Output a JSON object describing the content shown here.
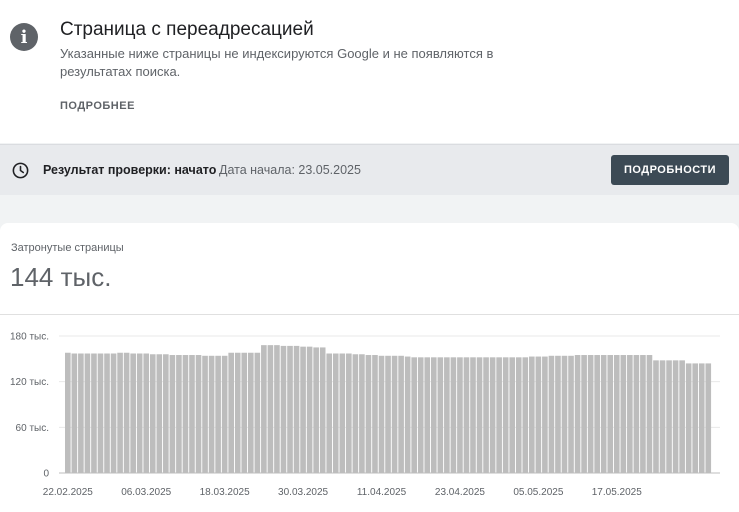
{
  "header": {
    "title": "Страница с переадресацией",
    "description": "Указанные ниже страницы не индексируются Google и не появляются в результатах поиска.",
    "more_link": "ПОДРОБНЕЕ",
    "icon": "info-icon"
  },
  "status": {
    "label": "Результат проверки: начато",
    "date_text": "Дата начала: 23.05.2025",
    "button": "ПОДРОБНОСТИ",
    "icon": "clock-icon"
  },
  "metric": {
    "label": "Затронутые страницы",
    "value": "144 тыс."
  },
  "chart_data": {
    "type": "bar",
    "bar_color": "#bdbdbd",
    "grid": true,
    "ylim": [
      0,
      180000
    ],
    "y_ticks": [
      {
        "value": 0,
        "label": "0"
      },
      {
        "value": 60000,
        "label": "60 тыс."
      },
      {
        "value": 120000,
        "label": "120 тыс."
      },
      {
        "value": 180000,
        "label": "180 тыс."
      }
    ],
    "x_tick_labels": [
      "22.02.2025",
      "06.03.2025",
      "18.03.2025",
      "30.03.2025",
      "11.04.2025",
      "23.04.2025",
      "05.05.2025",
      "17.05.2025"
    ],
    "x_tick_indices": [
      0,
      12,
      24,
      36,
      48,
      60,
      72,
      84
    ],
    "categories": [
      "22.02.2025",
      "23.02.2025",
      "24.02.2025",
      "25.02.2025",
      "26.02.2025",
      "27.02.2025",
      "28.02.2025",
      "01.03.2025",
      "02.03.2025",
      "03.03.2025",
      "04.03.2025",
      "05.03.2025",
      "06.03.2025",
      "07.03.2025",
      "08.03.2025",
      "09.03.2025",
      "10.03.2025",
      "11.03.2025",
      "12.03.2025",
      "13.03.2025",
      "14.03.2025",
      "15.03.2025",
      "16.03.2025",
      "17.03.2025",
      "18.03.2025",
      "19.03.2025",
      "20.03.2025",
      "21.03.2025",
      "22.03.2025",
      "23.03.2025",
      "24.03.2025",
      "25.03.2025",
      "26.03.2025",
      "27.03.2025",
      "28.03.2025",
      "29.03.2025",
      "30.03.2025",
      "31.03.2025",
      "01.04.2025",
      "02.04.2025",
      "03.04.2025",
      "04.04.2025",
      "05.04.2025",
      "06.04.2025",
      "07.04.2025",
      "08.04.2025",
      "09.04.2025",
      "10.04.2025",
      "11.04.2025",
      "12.04.2025",
      "13.04.2025",
      "14.04.2025",
      "15.04.2025",
      "16.04.2025",
      "17.04.2025",
      "18.04.2025",
      "19.04.2025",
      "20.04.2025",
      "21.04.2025",
      "22.04.2025",
      "23.04.2025",
      "24.04.2025",
      "25.04.2025",
      "26.04.2025",
      "27.04.2025",
      "28.04.2025",
      "29.04.2025",
      "30.04.2025",
      "01.05.2025",
      "02.05.2025",
      "03.05.2025",
      "04.05.2025",
      "05.05.2025",
      "06.05.2025",
      "07.05.2025",
      "08.05.2025",
      "09.05.2025",
      "10.05.2025",
      "11.05.2025",
      "12.05.2025",
      "13.05.2025",
      "14.05.2025",
      "15.05.2025",
      "16.05.2025",
      "17.05.2025",
      "18.05.2025",
      "19.05.2025",
      "20.05.2025",
      "21.05.2025"
    ],
    "values": [
      158000,
      157000,
      157000,
      157000,
      157000,
      157000,
      157000,
      157000,
      158000,
      158000,
      157000,
      157000,
      157000,
      156000,
      156000,
      156000,
      155000,
      155000,
      155000,
      155000,
      155000,
      154000,
      154000,
      154000,
      154000,
      158000,
      158000,
      158000,
      158000,
      158000,
      168000,
      168000,
      168000,
      167000,
      167000,
      167000,
      166000,
      166000,
      165000,
      165000,
      157000,
      157000,
      157000,
      157000,
      156000,
      156000,
      155000,
      155000,
      154000,
      154000,
      154000,
      154000,
      153000,
      152000,
      152000,
      152000,
      152000,
      152000,
      152000,
      152000,
      152000,
      152000,
      152000,
      152000,
      152000,
      152000,
      152000,
      152000,
      152000,
      152000,
      152000,
      153000,
      153000,
      153000,
      154000,
      154000,
      154000,
      154000,
      155000,
      155000,
      155000,
      155000,
      155000,
      155000,
      155000,
      155000,
      155000,
      155000,
      155000,
      155000,
      148000,
      148000,
      148000,
      148000,
      148000,
      144000,
      144000,
      144000,
      144000
    ]
  }
}
